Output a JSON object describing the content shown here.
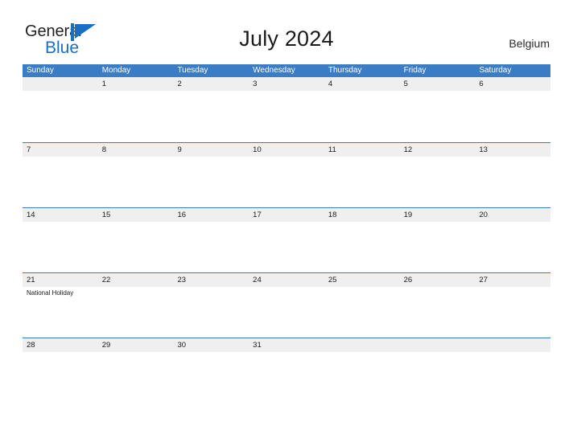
{
  "brand": {
    "name_part1": "General",
    "name_part2": "Blue",
    "flag_icon": "blue-flag-icon",
    "color_primary": "#1a6fc4",
    "color_dark": "#231f20"
  },
  "header": {
    "title": "July 2024",
    "country": "Belgium"
  },
  "calendar": {
    "header_bg": "#3b7dc4",
    "band_bg": "#efefef",
    "grid_line": "#3b7dc4",
    "day_names": [
      "Sunday",
      "Monday",
      "Tuesday",
      "Wednesday",
      "Thursday",
      "Friday",
      "Saturday"
    ],
    "weeks": [
      [
        {
          "num": "",
          "event": ""
        },
        {
          "num": "1",
          "event": ""
        },
        {
          "num": "2",
          "event": ""
        },
        {
          "num": "3",
          "event": ""
        },
        {
          "num": "4",
          "event": ""
        },
        {
          "num": "5",
          "event": ""
        },
        {
          "num": "6",
          "event": ""
        }
      ],
      [
        {
          "num": "7",
          "event": ""
        },
        {
          "num": "8",
          "event": ""
        },
        {
          "num": "9",
          "event": ""
        },
        {
          "num": "10",
          "event": ""
        },
        {
          "num": "11",
          "event": ""
        },
        {
          "num": "12",
          "event": ""
        },
        {
          "num": "13",
          "event": ""
        }
      ],
      [
        {
          "num": "14",
          "event": ""
        },
        {
          "num": "15",
          "event": ""
        },
        {
          "num": "16",
          "event": ""
        },
        {
          "num": "17",
          "event": ""
        },
        {
          "num": "18",
          "event": ""
        },
        {
          "num": "19",
          "event": ""
        },
        {
          "num": "20",
          "event": ""
        }
      ],
      [
        {
          "num": "21",
          "event": "National Holiday"
        },
        {
          "num": "22",
          "event": ""
        },
        {
          "num": "23",
          "event": ""
        },
        {
          "num": "24",
          "event": ""
        },
        {
          "num": "25",
          "event": ""
        },
        {
          "num": "26",
          "event": ""
        },
        {
          "num": "27",
          "event": ""
        }
      ],
      [
        {
          "num": "28",
          "event": ""
        },
        {
          "num": "29",
          "event": ""
        },
        {
          "num": "30",
          "event": ""
        },
        {
          "num": "31",
          "event": ""
        },
        {
          "num": "",
          "event": ""
        },
        {
          "num": "",
          "event": ""
        },
        {
          "num": "",
          "event": ""
        }
      ]
    ]
  }
}
